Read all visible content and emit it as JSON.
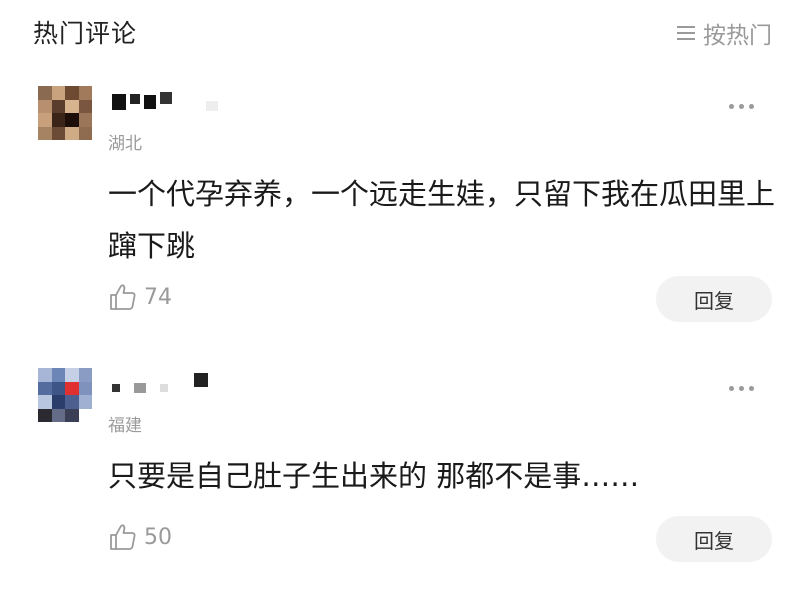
{
  "header": {
    "title": "热门评论",
    "sort_label": "按热门"
  },
  "comments": [
    {
      "location": "湖北",
      "text": "一个代孕弃养，一个远走生娃，只留下我在瓜田里上蹿下跳",
      "likes": "74",
      "reply_label": "回复",
      "avatar_colors": [
        "#8b6a52",
        "#c9a27e",
        "#6e4a33",
        "#a07a5b",
        "#b89070",
        "#5a3d2c",
        "#d8b48e",
        "#7a5540",
        "#c8a07c",
        "#3b2418",
        "#1c0e08",
        "#9c7658",
        "#a58363",
        "#6b4b36",
        "#d0ac86",
        "#8f6b50"
      ]
    },
    {
      "location": "福建",
      "text": "只要是自己肚子生出来的 那都不是事……",
      "likes": "50",
      "reply_label": "回复",
      "avatar_colors": [
        "#a7b6d6",
        "#6d86b8",
        "#c5d0e6",
        "#8a9cc4",
        "#556c9e",
        "#3e5588",
        "#e03030",
        "#7f92bd",
        "#b9c6e0",
        "#2b3d6b",
        "#4c5f8e",
        "#9fb0d3",
        "#2a2a30",
        "#646c88",
        "#3a3f55",
        "#ffffff"
      ]
    }
  ]
}
